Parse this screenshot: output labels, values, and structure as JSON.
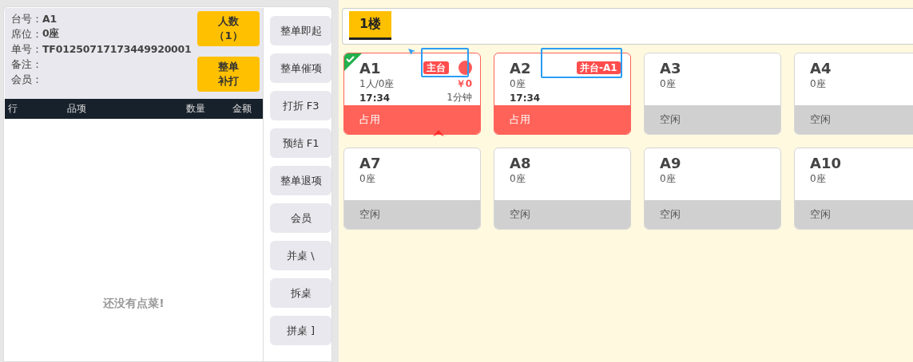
{
  "order_info": {
    "fields": [
      {
        "label": "台号：",
        "value": "A1"
      },
      {
        "label": "席位：",
        "value": "0座"
      },
      {
        "label": "单号：",
        "value": "TF01250717173449920001"
      },
      {
        "label": "备注："
      },
      {
        "label": "会员："
      }
    ],
    "quick_buttons": [
      {
        "lines": [
          "人数",
          "（1）"
        ]
      },
      {
        "lines": [
          "整单",
          "补打"
        ]
      }
    ]
  },
  "item_table": {
    "columns": [
      "行",
      "品项",
      "数量",
      "金额"
    ],
    "empty_text": "还没有点菜!"
  },
  "actions": [
    "整单即起",
    "整单催项",
    "打折 F3",
    "预结 F1",
    "整单退项",
    "会员",
    "并桌 \\",
    "拆桌",
    "拼桌 ]"
  ],
  "floors": [
    {
      "label": "1楼",
      "selected": true
    }
  ],
  "tables": [
    {
      "name": "A1",
      "seats": "1人/0座",
      "time": "17:34",
      "duration": "1分钟",
      "amount": "￥0",
      "tag": "主台",
      "notice": true,
      "selected": true,
      "kind": "occupied",
      "status_text": "占用"
    },
    {
      "name": "A2",
      "seats": "0座",
      "time": "17:34",
      "tag": "并台-A1",
      "notice": false,
      "selected": false,
      "kind": "occupied",
      "status_text": "占用"
    },
    {
      "name": "A3",
      "seats": "0座",
      "notice": false,
      "selected": false,
      "kind": "free",
      "status_text": "空闲"
    },
    {
      "name": "A4",
      "seats": "0座",
      "notice": false,
      "selected": false,
      "kind": "free",
      "status_text": "空闲"
    },
    {
      "name": "A7",
      "seats": "0座",
      "notice": false,
      "selected": false,
      "kind": "free",
      "status_text": "空闲"
    },
    {
      "name": "A8",
      "seats": "0座",
      "notice": false,
      "selected": false,
      "kind": "free",
      "status_text": "空闲"
    },
    {
      "name": "A9",
      "seats": "0座",
      "notice": false,
      "selected": false,
      "kind": "free",
      "status_text": "空闲"
    },
    {
      "name": "A10",
      "seats": "0座",
      "notice": false,
      "selected": false,
      "kind": "free",
      "status_text": "空闲"
    }
  ]
}
